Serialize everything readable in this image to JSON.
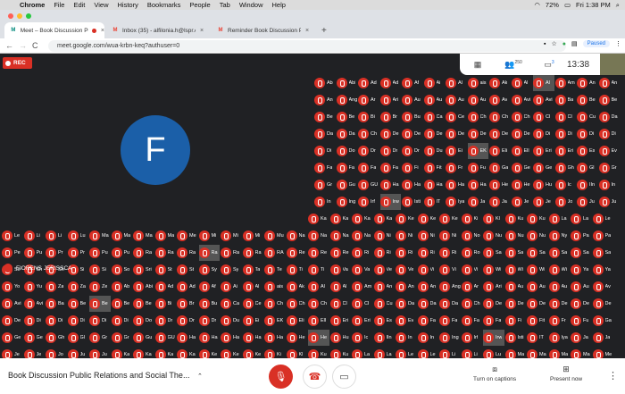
{
  "menubar": {
    "apple": "",
    "app": "Chrome",
    "items": [
      "File",
      "Edit",
      "View",
      "History",
      "Bookmarks",
      "People",
      "Tab",
      "Window",
      "Help"
    ],
    "battery": "72%",
    "clock": "Fri 1:38 PM"
  },
  "tabs": [
    {
      "title": "Meet – Book Discussion Pu",
      "active": true,
      "fav": "M",
      "favcolor": "#00897b"
    },
    {
      "title": "Inbox (35) - alfilonia.h@lspr.edu",
      "active": false,
      "fav": "M",
      "favcolor": "#ea4335"
    },
    {
      "title": "Reminder Book Discussion Pub",
      "active": false,
      "fav": "M",
      "favcolor": "#ea4335"
    }
  ],
  "newtab": "+",
  "address": {
    "url": "meet.google.com/wua-krbn-keq?authuser=0",
    "back": "←",
    "forward": "→",
    "reload": "C",
    "paused": "Paused"
  },
  "meet": {
    "rec": "REC",
    "presenter_initial": "F",
    "presenter_name": "FIORENS JERISSCA",
    "participants_count": "250",
    "chat_count": "3",
    "time": "13:38"
  },
  "grid_names": [
    "Ab",
    "Abi",
    "Ad",
    "Ad",
    "Af",
    "Ai",
    "Al",
    "ais",
    "Ak",
    "Al",
    "Al",
    "Am",
    "An",
    "An",
    "An",
    "Ang",
    "Ar",
    "Ari",
    "Au",
    "Au",
    "Au",
    "Au",
    "Av",
    "Avi",
    "Avi",
    "Ba",
    "Be",
    "Be",
    "Be",
    "Be",
    "Bi",
    "Br",
    "Bu",
    "Ca",
    "Ce",
    "Ch",
    "Ch",
    "Ch",
    "Cl",
    "Cl",
    "Cu",
    "Da",
    "Da",
    "Da",
    "Ch",
    "De",
    "De",
    "De",
    "De",
    "De",
    "De",
    "De",
    "Di",
    "Di",
    "Di",
    "Di",
    "Di",
    "Do",
    "Dr",
    "Dr",
    "Dr",
    "Du",
    "Ei",
    "EK",
    "Eli",
    "Ell",
    "Eri",
    "Eri",
    "Es",
    "Ev",
    "Fa",
    "Fa",
    "Fa",
    "Fa",
    "Fi",
    "Fit",
    "Fr",
    "Fu",
    "Ga",
    "Ge",
    "Ge",
    "Gh",
    "Gl",
    "Gr",
    "Gr",
    "Gu",
    "GU",
    "Ha",
    "Ha",
    "Ha",
    "Ha",
    "Ha",
    "He",
    "He",
    "Hu",
    "Ic",
    "IIn",
    "In",
    "In",
    "Ing",
    "Irf",
    "Irw",
    "Isti",
    "IT",
    "Iya",
    "Ja",
    "Ja",
    "Je",
    "Je",
    "Jo",
    "Ju",
    "Ju",
    "Ka",
    "Ka",
    "Ka",
    "Ka",
    "Ke",
    "Ke",
    "Ke",
    "Ki",
    "Kl",
    "Ku",
    "Ku",
    "La",
    "La",
    "Le",
    "Le",
    "Li",
    "Li",
    "Lu",
    "Ma",
    "Ma",
    "Ma",
    "Ma",
    "Me",
    "Mi",
    "Mi",
    "Mi",
    "Mu",
    "Na",
    "Na",
    "Na",
    "Na",
    "Ni",
    "Ni",
    "Ni",
    "Ni",
    "No",
    "Nu",
    "Nu",
    "Nu",
    "Ny",
    "Pa",
    "Pa",
    "Pe",
    "Pu",
    "Pr",
    "Pr",
    "Pu",
    "Pu",
    "Ra",
    "Ra",
    "Ra",
    "Ra",
    "Ra",
    "Ra",
    "RA",
    "Re",
    "Re",
    "Re",
    "Ri",
    "Ri",
    "Ri",
    "Ri",
    "Ri",
    "Ro",
    "Sa",
    "Sa",
    "Sa",
    "Sa",
    "Sa",
    "Sa",
    "Se",
    "Sh",
    "Sh",
    "Si",
    "Si",
    "So",
    "Sri",
    "St",
    "St",
    "Sy",
    "Sy",
    "Ta",
    "Te",
    "Ti",
    "Ti",
    "Va",
    "Va",
    "Ve",
    "Ve",
    "Vi",
    "Vi",
    "Vi",
    "Wi",
    "Wi",
    "Wi",
    "Wi",
    "Ya",
    "Ya",
    "Yo",
    "Yu",
    "Za",
    "Za",
    "Ze"
  ],
  "bottom": {
    "title": "Book Discussion Public Relations and Social The...",
    "chevron": "⌃",
    "captions": "Turn on captions",
    "present": "Present now",
    "more": "⋮"
  },
  "colors": {
    "mute": "#d93025",
    "bg": "#202124",
    "avatar": "#1b5fa8"
  }
}
